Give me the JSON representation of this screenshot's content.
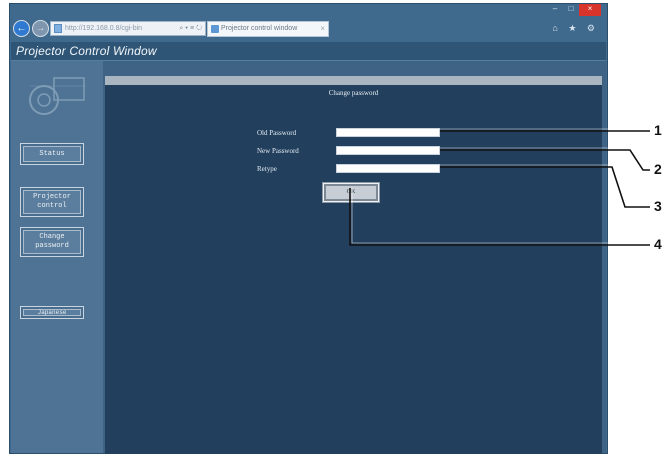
{
  "browser": {
    "address": "http://192.168.0.8/cgi-bin",
    "address_tools": "⌕ ▾ ≡ ↻",
    "tab_title": "Projector control window",
    "tab_close": "×",
    "window_controls": [
      "–",
      "□",
      "×"
    ],
    "toolbar_icons": "⌂ ★ ⚙",
    "back_icon": "←",
    "forward_icon": "→"
  },
  "app": {
    "title": "Projector Control Window"
  },
  "sidebar": {
    "items": [
      {
        "label": "Status"
      },
      {
        "label": "Projector\ncontrol"
      },
      {
        "label": "Change\npassword"
      },
      {
        "label": "Japanese"
      }
    ]
  },
  "content": {
    "title": "Change password",
    "fields": [
      {
        "label": "Old Password",
        "value": ""
      },
      {
        "label": "New Password",
        "value": ""
      },
      {
        "label": "Retype",
        "value": ""
      }
    ],
    "ok_label": "OK"
  },
  "callouts": [
    "1",
    "2",
    "3",
    "4"
  ],
  "colors": {
    "accent": "#3f6a8e",
    "content_bg": "#223f5d",
    "close_button": "#d9342b"
  }
}
